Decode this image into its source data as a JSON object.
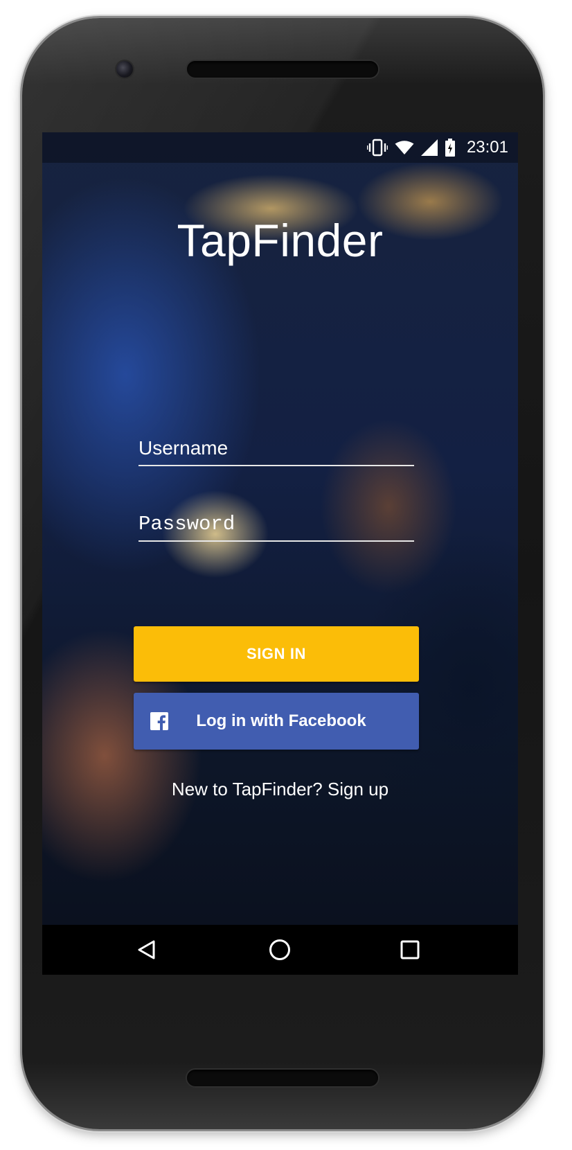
{
  "status_bar": {
    "time": "23:01",
    "icons": [
      "vibrate-icon",
      "wifi-icon",
      "signal-icon",
      "battery-icon"
    ]
  },
  "app": {
    "title": "TapFinder"
  },
  "login_form": {
    "username_placeholder": "Username",
    "password_placeholder": "Password",
    "sign_in_label": "SIGN IN",
    "facebook_label": "Log in with Facebook",
    "signup_text": "New to TapFinder? Sign up"
  },
  "nav_bar": {
    "buttons": [
      "back-icon",
      "home-icon",
      "recents-icon"
    ]
  },
  "colors": {
    "sign_in_button": "#fbbd08",
    "facebook_button": "#415db0",
    "text": "#ffffff",
    "nav_bar": "#000000"
  }
}
